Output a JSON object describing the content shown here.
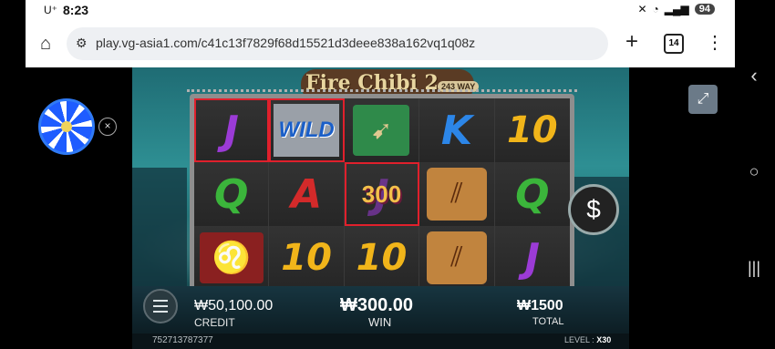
{
  "status_bar": {
    "carrier": "U⁺",
    "time": "8:23",
    "battery": "94"
  },
  "browser": {
    "url": "play.vg-asia1.com/c41c13f7829f68d15521d3deee838a162vq1q08z",
    "tab_count": "14"
  },
  "game": {
    "logo_title": "Fire Chibi 2",
    "logo_ways": "243 WAY",
    "reels": [
      [
        "J",
        "WILD",
        "scroll",
        "K",
        "10"
      ],
      [
        "Q",
        "A",
        "300",
        "arrows",
        "Q"
      ],
      [
        "lion",
        "10",
        "10",
        "arrows",
        "J"
      ]
    ],
    "win_value_on_reel": "300",
    "credit_value": "₩50,100.00",
    "credit_label": "CREDIT",
    "win_value": "₩300.00",
    "win_label": "WIN",
    "total_value": "₩1500",
    "total_label": "TOTAL",
    "spin_icon_label": "$",
    "round_id": "752713787377",
    "level_label": "LEVEL : ",
    "level_value": "X30"
  },
  "icons": [
    "home-icon",
    "site-settings-icon",
    "plus-icon",
    "tabs-icon",
    "menu-icon",
    "back-icon",
    "home-circle-icon",
    "recents-icon",
    "expand-icon",
    "wheel-icon",
    "close-icon",
    "dollar-icon",
    "hamburger-icon"
  ]
}
